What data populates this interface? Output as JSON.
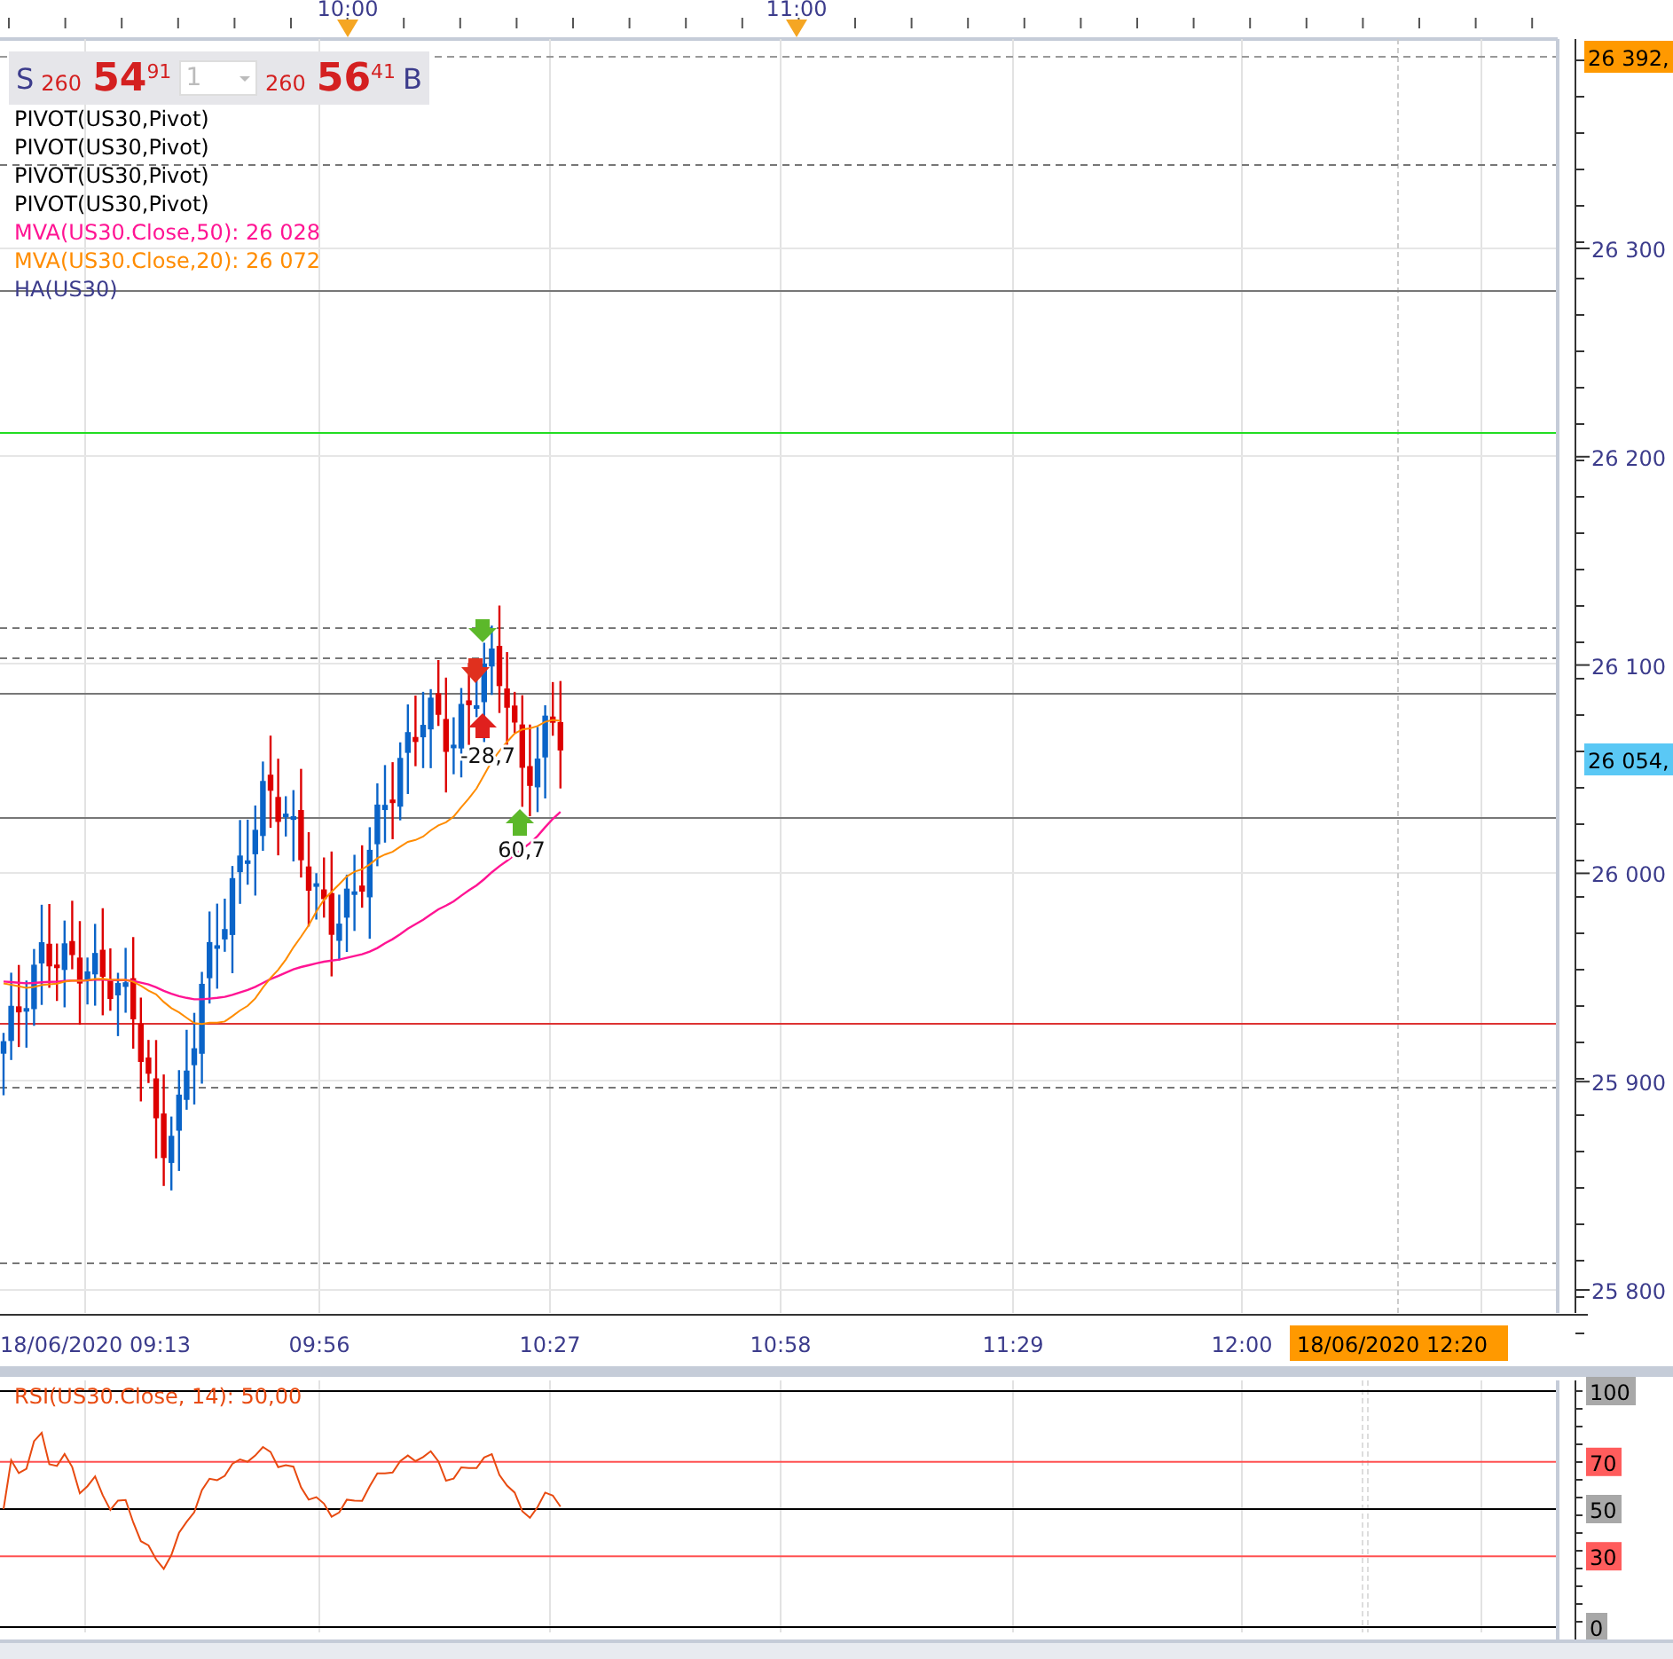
{
  "time_axis_top": [
    "10:00",
    "11:00"
  ],
  "quote": {
    "sell_label": "S",
    "sell_prefix": "260",
    "sell_big": "54",
    "sell_small": "91",
    "quantity": "1",
    "buy_prefix": "260",
    "buy_big": "56",
    "buy_small": "41",
    "buy_label": "B"
  },
  "legend": [
    {
      "text": "PIVOT(US30,Pivot)",
      "color": "#000000"
    },
    {
      "text": "PIVOT(US30,Pivot)",
      "color": "#000000"
    },
    {
      "text": "PIVOT(US30,Pivot)",
      "color": "#000000"
    },
    {
      "text": "PIVOT(US30,Pivot)",
      "color": "#000000"
    },
    {
      "text": "MVA(US30.Close,50): 26 028",
      "color": "#ff1493"
    },
    {
      "text": "MVA(US30.Close,20): 26 072",
      "color": "#ff8c00"
    },
    {
      "text": "HA(US30)",
      "color": "#3c3c8c"
    }
  ],
  "price_axis": [
    "26 300",
    "26 200",
    "26 100",
    "26 000",
    "25 900",
    "25 800"
  ],
  "price_tags": [
    {
      "text": "26 392,",
      "color": "#ff9900"
    },
    {
      "text": "26 054,",
      "color": "#5ac8f5"
    }
  ],
  "annotations": [
    "-28,7",
    "60,7"
  ],
  "time_axis": [
    "18/06/2020 09:13",
    "09:56",
    "10:27",
    "10:58",
    "11:29",
    "12:00"
  ],
  "cursor_time": "18/06/2020 12:20",
  "rsi": {
    "label": "RSI(US30.Close, 14): 50,00",
    "levels": [
      {
        "text": "100",
        "kind": "bound"
      },
      {
        "text": "70",
        "kind": "threshold"
      },
      {
        "text": "50",
        "kind": "bound"
      },
      {
        "text": "30",
        "kind": "threshold"
      },
      {
        "text": "0",
        "kind": "bound"
      }
    ]
  }
}
